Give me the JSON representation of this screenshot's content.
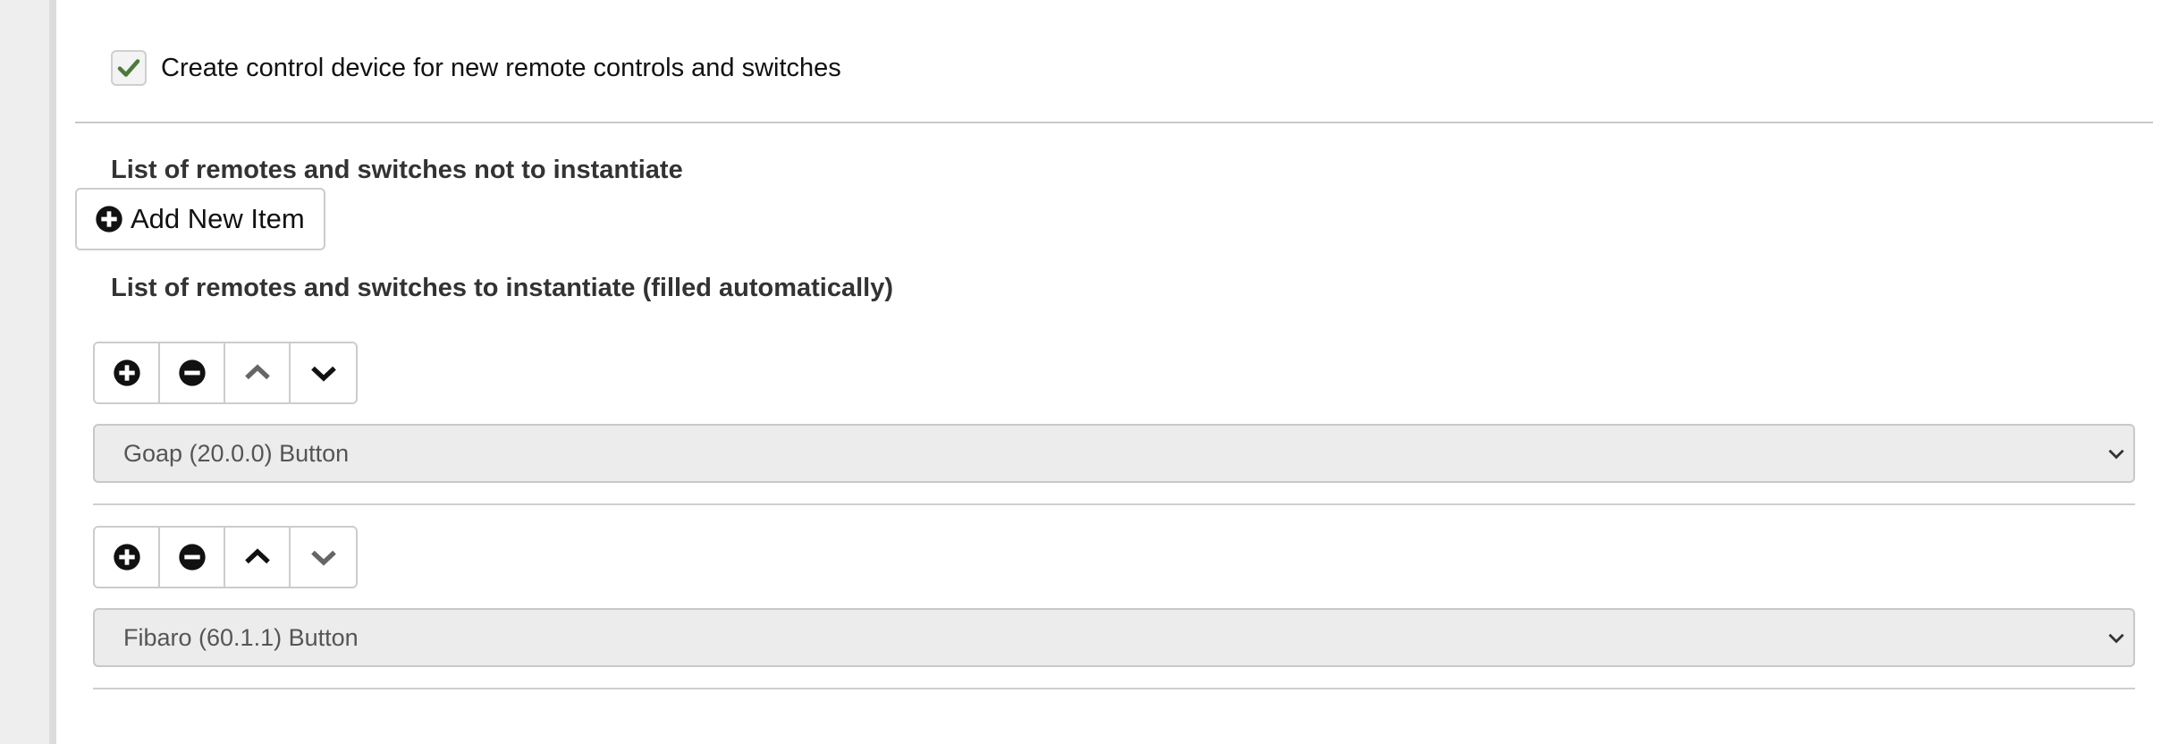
{
  "settings": {
    "create_control_device": {
      "label": "Create control device for new remote controls and switches",
      "checked": true
    },
    "not_instantiate": {
      "heading": "List of remotes and switches not to instantiate",
      "add_button_label": "Add New Item"
    },
    "instantiate": {
      "heading": "List of remotes and switches to instantiate (filled automatically)",
      "items": [
        {
          "value": "Goap (20.0.0) Button",
          "controls": {
            "add": "plus-circle-icon",
            "remove": "minus-circle-icon",
            "up": "chevron-up-icon",
            "down": "chevron-down-icon"
          },
          "up_enabled": false,
          "down_enabled": true
        },
        {
          "value": "Fibaro (60.1.1) Button",
          "controls": {
            "add": "plus-circle-icon",
            "remove": "minus-circle-icon",
            "up": "chevron-up-icon",
            "down": "chevron-down-icon"
          },
          "up_enabled": true,
          "down_enabled": false
        }
      ]
    }
  },
  "colors": {
    "checkmark": "#4a7a3c",
    "gutter": "#eeeeee",
    "select_bg": "#ececec",
    "disabled_icon": "#666666",
    "enabled_icon": "#111111"
  }
}
